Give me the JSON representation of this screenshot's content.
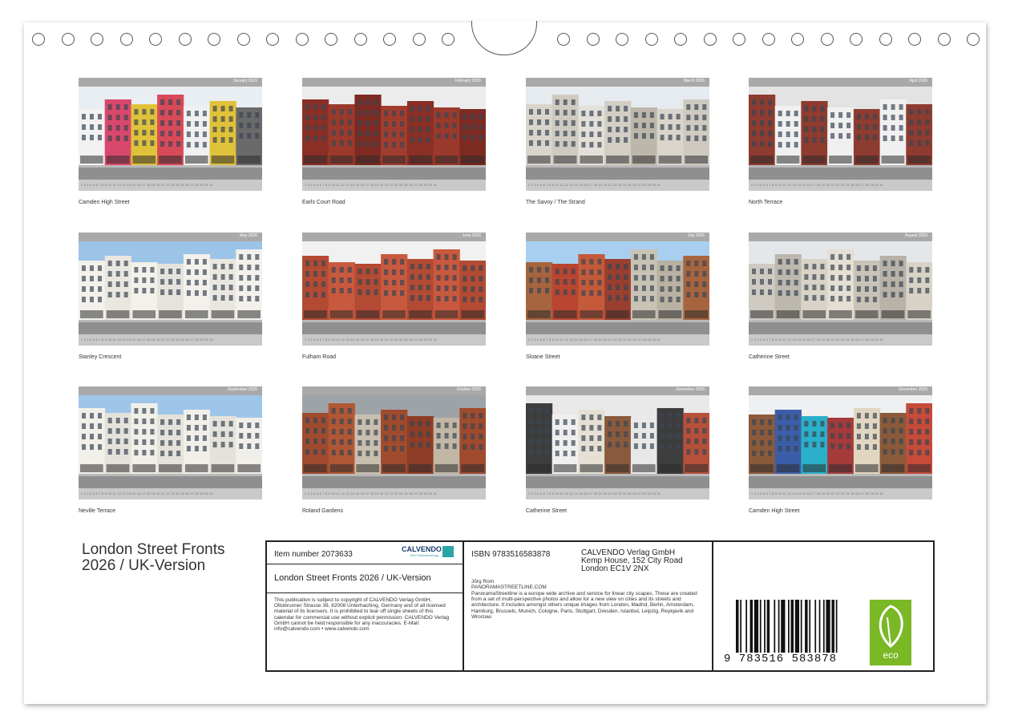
{
  "months": [
    {
      "month": "January 2026",
      "caption": "Camden High Street"
    },
    {
      "month": "February 2026",
      "caption": "Earls Court Road"
    },
    {
      "month": "March 2026",
      "caption": "The Savoy / The Strand"
    },
    {
      "month": "April 2026",
      "caption": "North Terrace"
    },
    {
      "month": "May 2026",
      "caption": "Stanley Crescent"
    },
    {
      "month": "June 2026",
      "caption": "Fulham Road"
    },
    {
      "month": "July 2026",
      "caption": "Sloane Street"
    },
    {
      "month": "August 2026",
      "caption": "Catherine Street"
    },
    {
      "month": "September 2026",
      "caption": "Neville Terrace"
    },
    {
      "month": "October 2026",
      "caption": "Roland Gardens"
    },
    {
      "month": "November 2026",
      "caption": "Catherine Street"
    },
    {
      "month": "December 2026",
      "caption": "Camden High Street"
    }
  ],
  "days_strip": "1 2 3 4 5 6 7 8 9 10 11 12 13 14 15 16 17 18 19 20 21 22 23 24 25 26 27 28 29 30 31",
  "title": {
    "line1": "London Street Fronts",
    "line2": "2026 / UK-Version"
  },
  "info": {
    "item_number": "Item number 2073633",
    "brand": "CALVENDO",
    "brand_sub": "Ihre Kalenderverlag",
    "product_title": "London Street Fronts 2026 / UK-Version",
    "legal": "This publication is subject to copyright of CALVENDO Verlag GmbH, Ottobrunner Strasse 39, 82008 Unterhaching, Germany and of all licensed material of its licensers. It is prohibited to tear off single sheets of this calendar for commercial use without explicit permission. CALVENDO Verlag GmbH cannot be held responsible for any inaccuracies. E-Mail: info@calvendo.com • www.calvendo.com",
    "isbn": "ISBN 9783516583878",
    "publisher_line1": "CALVENDO Verlag GmbH",
    "publisher_line2": "Kemp House, 152 City Road",
    "publisher_line3": "London EC1V 2NX",
    "author": "Jörg Rom",
    "website": "PANORAMASTREETLINE.COM",
    "description": "PanoramaStreetline is a europe wide archive and service for linear city scapes. These are created from a set of multi-perspective photos and allow for a new view on cities and its streets and architecture. It includes amongst others unique images from London, Madrid, Berlin, Amsterdam, Hamburg, Brussels, Munich, Cologne, Paris, Stuttgart, Dresden, Istanbul, Leipzig, Reykjavik and Wroclaw.",
    "barcode_number": "9 783516 583878",
    "eco_label": "eco"
  }
}
